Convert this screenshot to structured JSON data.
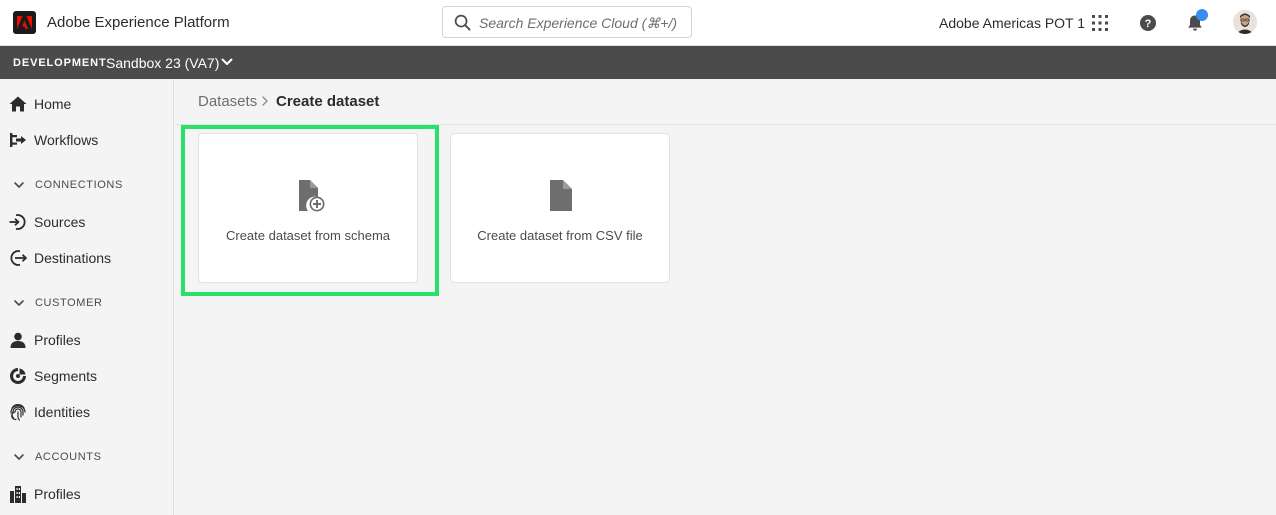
{
  "header": {
    "app_title": "Adobe Experience Platform",
    "search_placeholder": "Search Experience Cloud (⌘+/)",
    "org_name": "Adobe Americas POT 1",
    "icons": [
      "apps-grid-icon",
      "help-icon",
      "notifications-bell-icon",
      "user-avatar"
    ],
    "notification_dot_color": "#378ef0"
  },
  "sandbox_bar": {
    "environment": "DEVELOPMENT",
    "sandbox": "Sandbox 23 (VA7)"
  },
  "sidebar": {
    "items_top": [
      {
        "label": "Home",
        "icon": "home-icon"
      },
      {
        "label": "Workflows",
        "icon": "workflow-icon"
      }
    ],
    "sections": [
      {
        "title": "CONNECTIONS",
        "items": [
          {
            "label": "Sources",
            "icon": "sources-icon"
          },
          {
            "label": "Destinations",
            "icon": "destinations-icon"
          }
        ]
      },
      {
        "title": "CUSTOMER",
        "items": [
          {
            "label": "Profiles",
            "icon": "profile-icon"
          },
          {
            "label": "Segments",
            "icon": "segments-icon"
          },
          {
            "label": "Identities",
            "icon": "fingerprint-icon"
          }
        ]
      },
      {
        "title": "ACCOUNTS",
        "items": [
          {
            "label": "Profiles",
            "icon": "building-icon"
          }
        ]
      }
    ]
  },
  "breadcrumb": {
    "parent": "Datasets",
    "current": "Create dataset"
  },
  "cards": [
    {
      "label": "Create dataset from schema",
      "icon": "document-add-icon",
      "highlighted": true
    },
    {
      "label": "Create dataset from CSV file",
      "icon": "document-icon",
      "highlighted": false
    }
  ],
  "colors": {
    "highlight": "#2ae06a",
    "sandbox_bar": "#4b4b4b",
    "brand_logo": "#eb1000"
  }
}
